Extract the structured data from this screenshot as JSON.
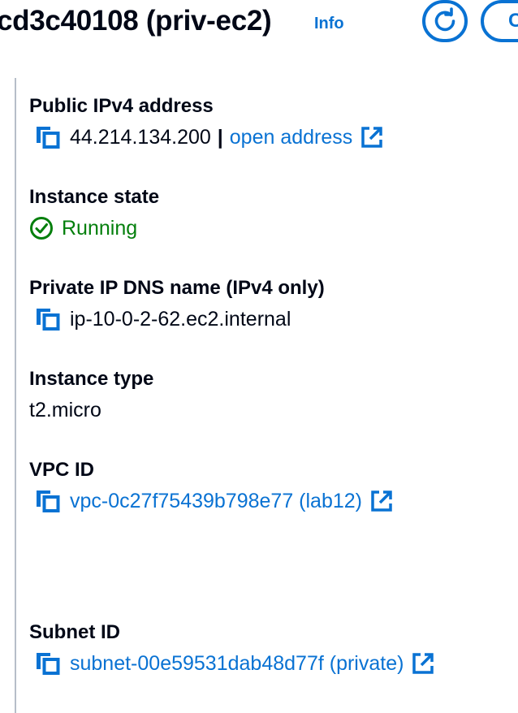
{
  "header": {
    "title": "cd3c40108 (priv-ec2)",
    "info_label": "Info",
    "next_button_label": "C"
  },
  "details": {
    "public_ipv4": {
      "label": "Public IPv4 address",
      "value": "44.214.134.200",
      "separator": "|",
      "link_label": "open address"
    },
    "instance_state": {
      "label": "Instance state",
      "value": "Running"
    },
    "private_dns": {
      "label": "Private IP DNS name (IPv4 only)",
      "value": "ip-10-0-2-62.ec2.internal"
    },
    "instance_type": {
      "label": "Instance type",
      "value": "t2.micro"
    },
    "vpc_id": {
      "label": "VPC ID",
      "value": "vpc-0c27f75439b798e77 (lab12)"
    },
    "subnet_id": {
      "label": "Subnet ID",
      "value": "subnet-00e59531dab48d77f (private)"
    }
  },
  "icons": {
    "copy": "copy-icon",
    "external": "external-link-icon",
    "status": "check-circle-icon",
    "refresh": "refresh-icon"
  },
  "colors": {
    "link": "#0972d3",
    "text": "#000716",
    "success": "#037f0c",
    "divider": "#b6bec9"
  }
}
